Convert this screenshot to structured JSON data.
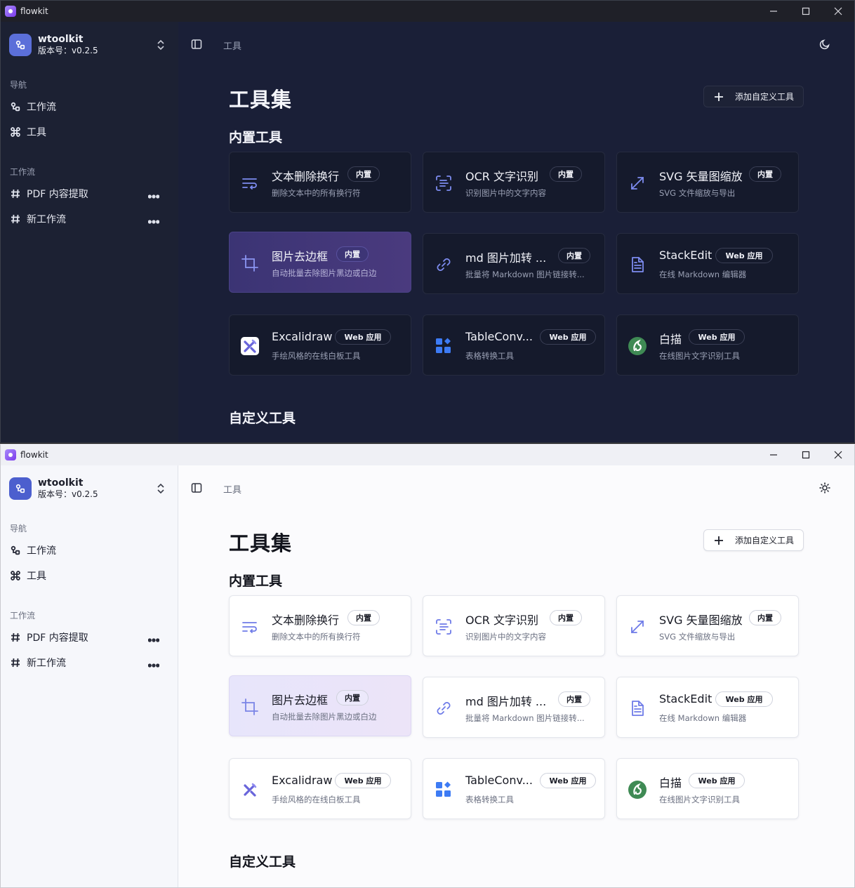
{
  "window": {
    "title": "flowkit"
  },
  "workspace": {
    "name": "wtoolkit",
    "version": "版本号：v0.2.5"
  },
  "sidebar": {
    "nav_label": "导航",
    "nav_items": [
      {
        "label": "工作流",
        "icon": "workflow-icon"
      },
      {
        "label": "工具",
        "icon": "command-icon"
      }
    ],
    "flows_label": "工作流",
    "flows": [
      {
        "label": "PDF 内容提取",
        "icon": "hash-icon"
      },
      {
        "label": "新工作流",
        "icon": "hash-icon"
      }
    ]
  },
  "header": {
    "breadcrumb": "工具"
  },
  "main": {
    "title": "工具集",
    "add_button": "添加自定义工具",
    "builtin_section": "内置工具",
    "custom_section": "自定义工具",
    "tools": [
      {
        "name": "文本删除换行",
        "badge": "内置",
        "desc": "删除文本中的所有换行符",
        "icon": "wrap-text-icon"
      },
      {
        "name": "OCR 文字识别",
        "badge": "内置",
        "desc": "识别图片中的文字内容",
        "icon": "scan-text-icon"
      },
      {
        "name": "SVG 矢量图缩放",
        "badge": "内置",
        "desc": "SVG 文件缩放与导出",
        "icon": "resize-icon"
      },
      {
        "name": "图片去边框",
        "badge": "内置",
        "desc": "自动批量去除图片黑边或白边",
        "icon": "crop-icon"
      },
      {
        "name": "md 图片加转 ...",
        "badge": "内置",
        "desc": "批量将 Markdown 图片链接转...",
        "icon": "link-icon"
      },
      {
        "name": "StackEdit",
        "badge": "Web 应用",
        "desc": "在线 Markdown 编辑器",
        "icon": "document-icon"
      },
      {
        "name": "Excalidraw",
        "badge": "Web 应用",
        "desc": "手绘风格的在线白板工具",
        "icon": "excalidraw-icon"
      },
      {
        "name": "TableConv...",
        "badge": "Web 应用",
        "desc": "表格转换工具",
        "icon": "tableconvert-icon"
      },
      {
        "name": "白描",
        "badge": "Web 应用",
        "desc": "在线图片文字识别工具",
        "icon": "baimiao-icon"
      }
    ]
  },
  "colors": {
    "accent_dark": "#5b6fd9",
    "accent_light": "#4c5fce",
    "dark_bg": "#1a1f37",
    "light_bg": "#fbfbfd"
  }
}
